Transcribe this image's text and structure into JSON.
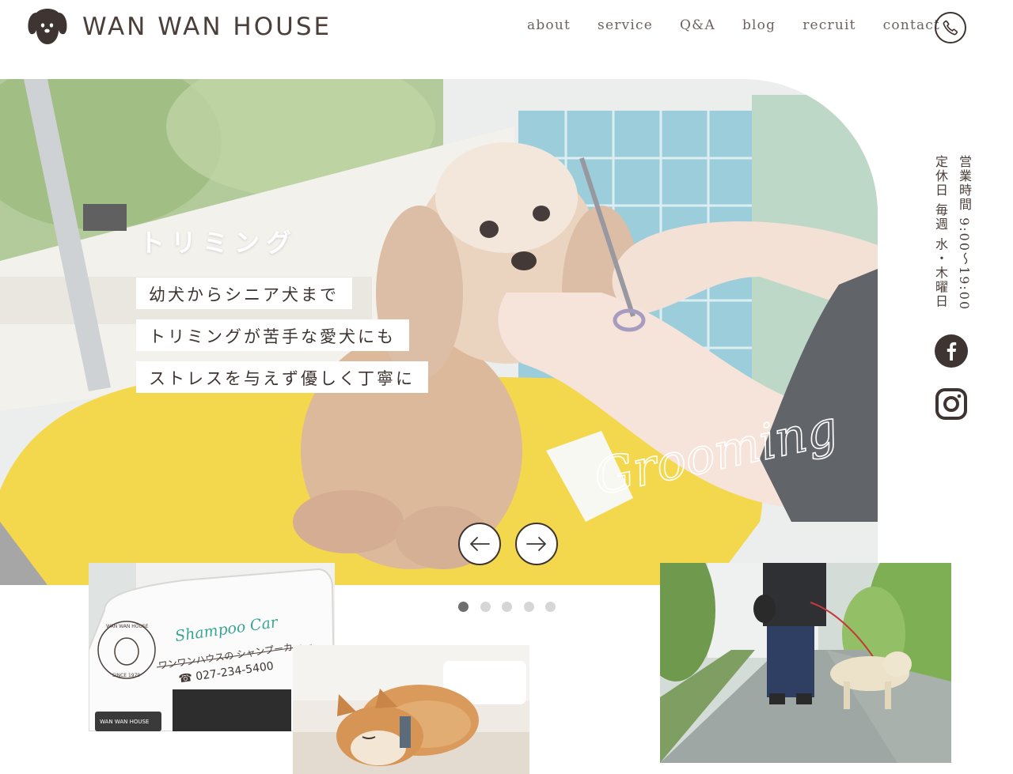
{
  "brand": {
    "name": "WAN WAN HOUSE"
  },
  "nav": {
    "items": [
      {
        "label": "about"
      },
      {
        "label": "service"
      },
      {
        "label": "Q&A"
      },
      {
        "label": "blog"
      },
      {
        "label": "recruit"
      },
      {
        "label": "contact"
      }
    ]
  },
  "hero": {
    "title": "トリミング",
    "captions": [
      "幼犬からシニア犬まで",
      "トリミングが苦手な愛犬にも",
      "ストレスを与えず優しく丁寧に"
    ],
    "script_word": "Grooming"
  },
  "slider": {
    "total_slides": 5,
    "active_slide": 1
  },
  "info": {
    "hours": "営業時間 9:00〜19:00",
    "holiday": "定休日 毎週 水・木曜日"
  },
  "shampoo_car": {
    "title": "Shampoo Car",
    "subtitle": "ワンワンハウスの シャンプーカー",
    "phone": "☎ 027-234-5400",
    "badge_top": "WAN WAN HOUSE",
    "badge_bottom": "SINCE 1979",
    "plate": "WAN WAN HOUSE"
  },
  "colors": {
    "text": "#4a3f3a",
    "nav": "#6e625c",
    "icon": "#3e3532",
    "accent_teal": "#3aa596",
    "table_yellow": "#f2d335"
  }
}
